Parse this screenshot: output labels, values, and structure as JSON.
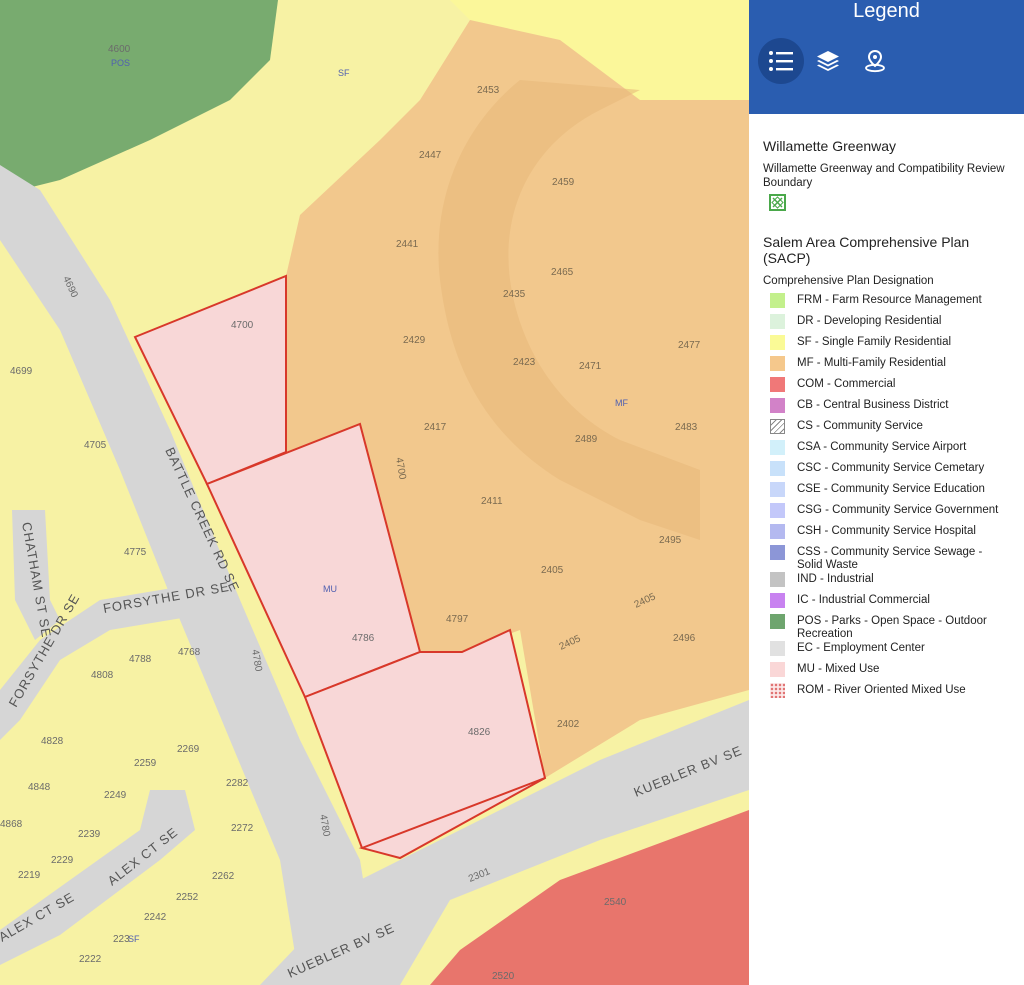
{
  "panel": {
    "title": "Legend",
    "tools": [
      {
        "name": "legend-list-icon",
        "active": true
      },
      {
        "name": "layers-icon",
        "active": false
      },
      {
        "name": "locate-pin-icon",
        "active": false
      }
    ],
    "greenway": {
      "title": "Willamette Greenway",
      "subtitle": "Willamette Greenway and Compatibility Review Boundary",
      "swatch_color": "#4aa84a"
    },
    "sacp": {
      "title": "Salem Area Comprehensive Plan (SACP)",
      "subtitle": "Comprehensive Plan Designation",
      "items": [
        {
          "label": "FRM - Farm Resource Management",
          "color": "#c3f08c"
        },
        {
          "label": "DR - Developing Residential",
          "color": "#dcf2dc"
        },
        {
          "label": "SF - Single Family Residential",
          "color": "#fafa96"
        },
        {
          "label": "MF - Multi-Family Residential",
          "color": "#f5c88c"
        },
        {
          "label": "COM - Commercial",
          "color": "#f07878"
        },
        {
          "label": "CB - Central Business District",
          "color": "#d282c8"
        },
        {
          "label": "CS - Community Service",
          "color": "hatch"
        },
        {
          "label": "CSA - Community Service Airport",
          "color": "#d2f0fa"
        },
        {
          "label": "CSC - Community Service Cemetary",
          "color": "#c8e1fa"
        },
        {
          "label": "CSE - Community Service Education",
          "color": "#c8d7fa"
        },
        {
          "label": "CSG - Community Service Government",
          "color": "#c3c8fa"
        },
        {
          "label": "CSH - Community Service Hospital",
          "color": "#b4b9f0"
        },
        {
          "label": "CSS - Community Service Sewage - Solid Waste",
          "color": "#8c96d7"
        },
        {
          "label": "IND - Industrial",
          "color": "#c3c3c3"
        },
        {
          "label": "IC - Industrial Commercial",
          "color": "#c882f0"
        },
        {
          "label": "POS - Parks - Open Space - Outdoor Recreation",
          "color": "#6ea56e"
        },
        {
          "label": "EC - Employment Center",
          "color": "#e1e1e1"
        },
        {
          "label": "MU - Mixed Use",
          "color": "#fad7d7"
        },
        {
          "label": "ROM - River Oriented Mixed Use",
          "color": "dots"
        }
      ]
    }
  },
  "map": {
    "zones": {
      "pos": "POS",
      "sf_top": "SF",
      "mf": "MF",
      "mu": "MU",
      "sf_bottom": "SF"
    },
    "roads": {
      "battle_creek": "BATTLE CREEK RD SE",
      "forsythe": "FORSYTHE DR SE",
      "forsythe_2": "FORSYTHE DR SE",
      "chatham": "CHATHAM ST SE",
      "kuebler_1": "KUEBLER BV SE",
      "kuebler_2": "KUEBLER BV SE",
      "alex_1": "ALEX CT SE",
      "alex_2": "ALEX CT SE"
    },
    "addresses": {
      "a4600": "4600",
      "a2453": "2453",
      "a2447": "2447",
      "a2459": "2459",
      "a2441": "2441",
      "a2465": "2465",
      "a2435": "2435",
      "a4690": "4690",
      "a4700": "4700",
      "a2429": "2429",
      "a2477": "2477",
      "a2423": "2423",
      "a2471": "2471",
      "a4699": "4699",
      "a2417": "2417",
      "a2483": "2483",
      "a2489": "2489",
      "a4705": "4705",
      "a4700b": "4700",
      "a2411": "2411",
      "a2495": "2495",
      "a4775": "4775",
      "a2405": "2405",
      "a2405b": "2405",
      "a2405c": "2405",
      "a4797": "4797",
      "a4786": "4786",
      "a2496": "2496",
      "a4788": "4788",
      "a4768": "4768",
      "a4808": "4808",
      "a4780": "4780",
      "a2402": "2402",
      "a4826": "4826",
      "a4828": "4828",
      "a2269": "2269",
      "a2259": "2259",
      "a2282": "2282",
      "a4848": "4848",
      "a2249": "2249",
      "a4868": "4868",
      "a2239": "2239",
      "a2272": "2272",
      "a4780b": "4780",
      "a2229": "2229",
      "a2219": "2219",
      "a2262": "2262",
      "a2301": "2301",
      "a2252": "2252",
      "a2540": "2540",
      "a2242": "2242",
      "a2232": "223",
      "a2222": "2222",
      "a2520": "2520"
    }
  }
}
